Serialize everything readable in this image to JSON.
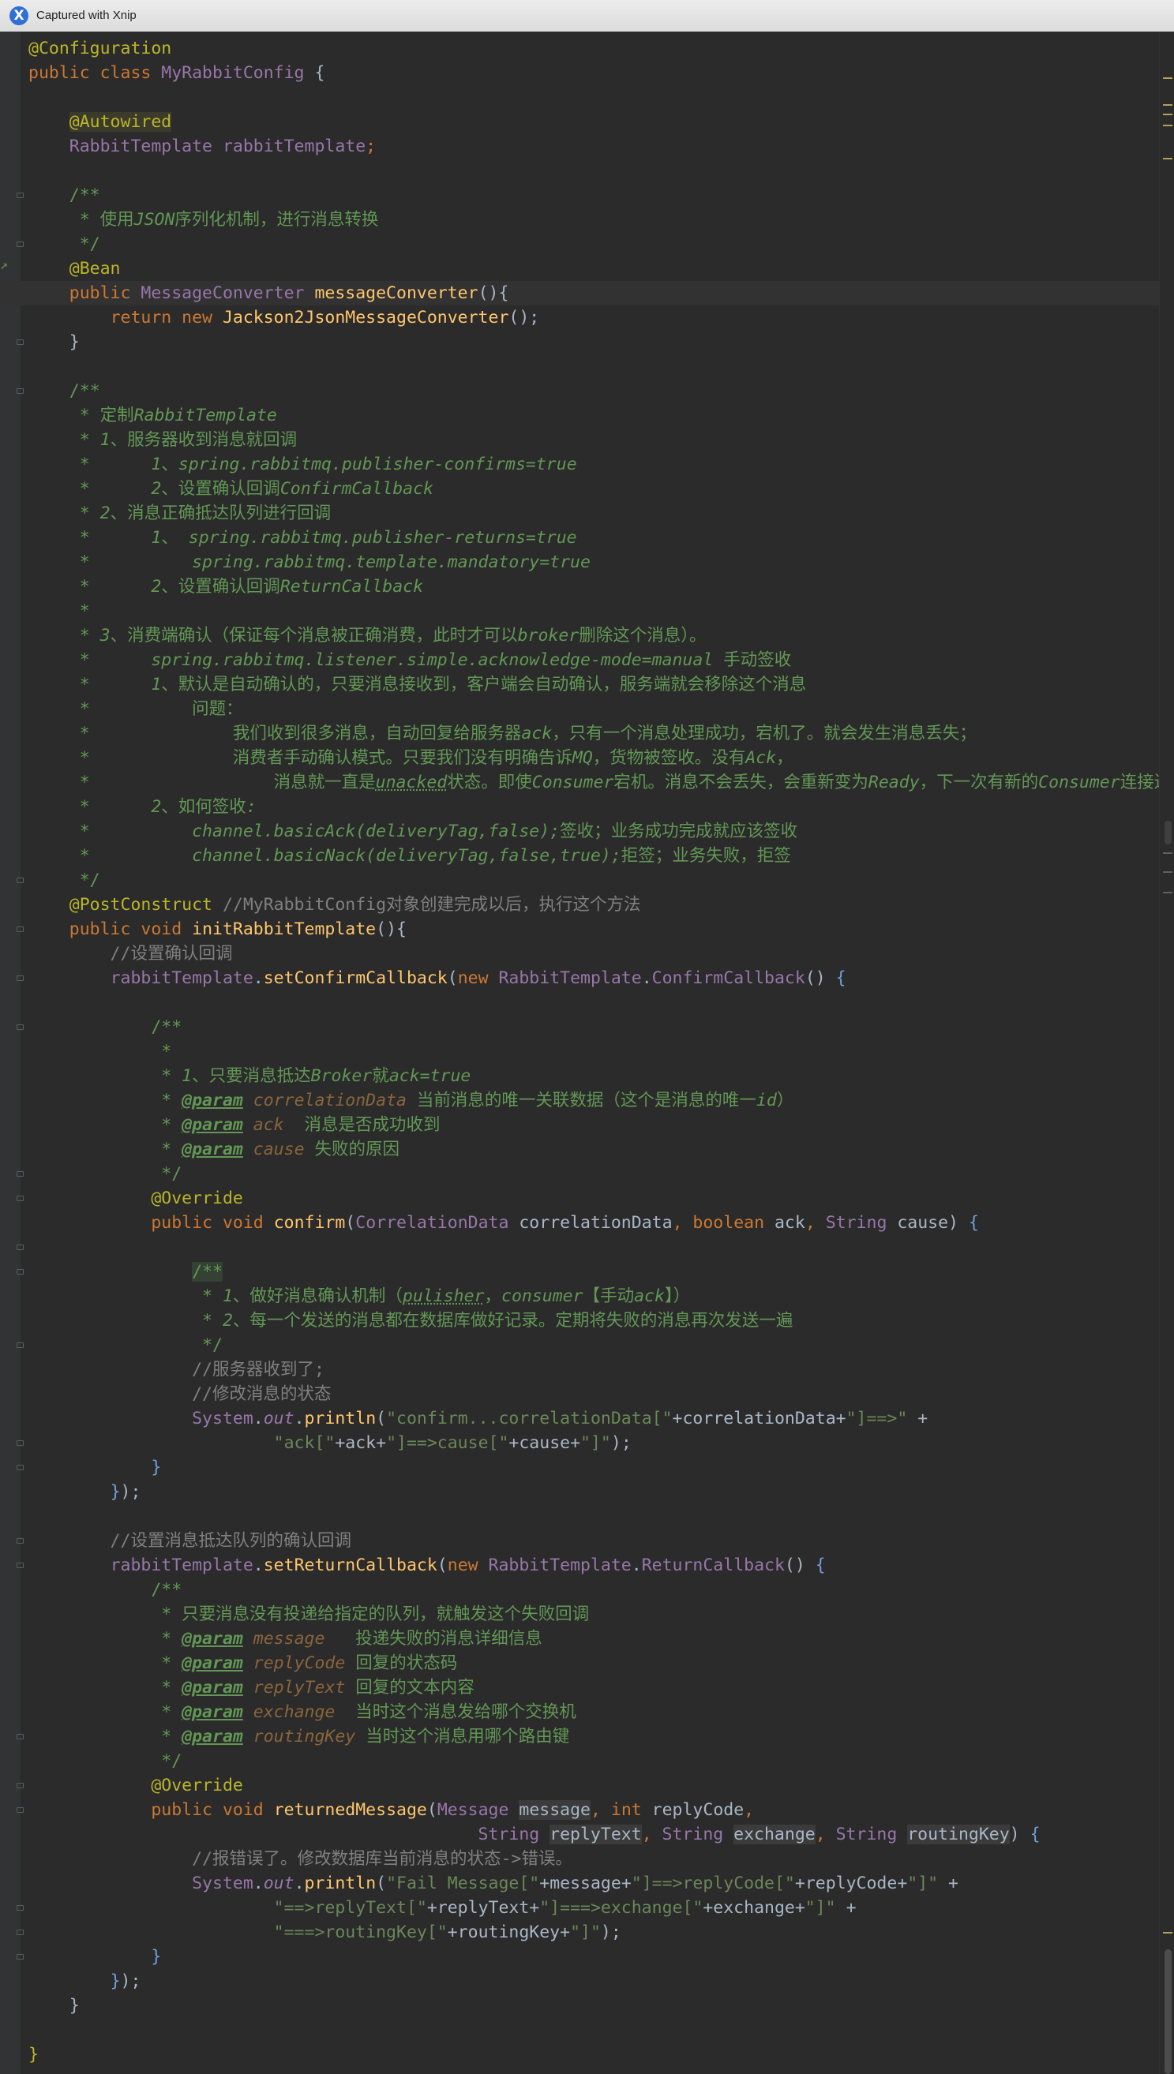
{
  "window": {
    "title": "Captured with Xnip",
    "app_icon_glyph": "X",
    "app_icon_color": "#2f6fd6"
  },
  "colors": {
    "background": "#2b2b2b",
    "keyword": "#cc7832",
    "annotation": "#bbb529",
    "class": "#9876aa",
    "method": "#ffc66d",
    "string": "#6a8759",
    "comment": "#808080",
    "doc": "#629755"
  },
  "gutter_icons": [
    "fold-icon",
    "bean-icon"
  ],
  "code": {
    "lines": [
      [
        [
          "an",
          "@Configuration"
        ]
      ],
      [
        [
          "kw",
          "public class "
        ],
        [
          "cls",
          "MyRabbitConfig "
        ],
        [
          "",
          "{"
        ]
      ],
      [
        [
          "",
          ""
        ]
      ],
      [
        [
          "",
          "    "
        ],
        [
          "an-hl",
          "@Autowired"
        ]
      ],
      [
        [
          "",
          "    "
        ],
        [
          "cls",
          "RabbitTemplate "
        ],
        [
          "fld",
          "rabbitTemplate"
        ],
        [
          "kw",
          ";"
        ]
      ],
      [
        [
          "",
          ""
        ]
      ],
      [
        [
          "dc",
          "    /**"
        ]
      ],
      [
        [
          "dc",
          "     * 使用"
        ],
        [
          "dci",
          "JSON"
        ],
        [
          "dc",
          "序列化机制，进行消息转换"
        ]
      ],
      [
        [
          "dc",
          "     */"
        ]
      ],
      [
        [
          "",
          "    "
        ],
        [
          "an",
          "@Bean"
        ]
      ],
      [
        [
          "",
          "    "
        ],
        [
          "kw",
          "public "
        ],
        [
          "cls",
          "MessageConverter "
        ],
        [
          "fn",
          "messageConverter"
        ],
        [
          "",
          "(){"
        ]
      ],
      [
        [
          "",
          "        "
        ],
        [
          "kw",
          "return new "
        ],
        [
          "fn",
          "Jackson2JsonMessageConverter"
        ],
        [
          "",
          "();"
        ]
      ],
      [
        [
          "",
          "    }"
        ]
      ],
      [
        [
          "",
          ""
        ]
      ],
      [
        [
          "dc",
          "    /**"
        ]
      ],
      [
        [
          "dc",
          "     * 定制"
        ],
        [
          "dci",
          "RabbitTemplate"
        ]
      ],
      [
        [
          "dc",
          "     * "
        ],
        [
          "dci",
          "1"
        ],
        [
          "dc",
          "、服务器收到消息就回调"
        ]
      ],
      [
        [
          "dc",
          "     *      "
        ],
        [
          "dci",
          "1"
        ],
        [
          "dc",
          "、"
        ],
        [
          "dci",
          "spring.rabbitmq.publisher-confirms=true"
        ]
      ],
      [
        [
          "dc",
          "     *      "
        ],
        [
          "dci",
          "2"
        ],
        [
          "dc",
          "、设置确认回调"
        ],
        [
          "dci",
          "ConfirmCallback"
        ]
      ],
      [
        [
          "dc",
          "     * "
        ],
        [
          "dci",
          "2"
        ],
        [
          "dc",
          "、消息正确抵达队列进行回调"
        ]
      ],
      [
        [
          "dc",
          "     *      "
        ],
        [
          "dci",
          "1"
        ],
        [
          "dc",
          "、 "
        ],
        [
          "dci",
          "spring.rabbitmq.publisher-returns=true"
        ]
      ],
      [
        [
          "dc",
          "     *          "
        ],
        [
          "dci",
          "spring.rabbitmq.template.mandatory=true"
        ]
      ],
      [
        [
          "dc",
          "     *      "
        ],
        [
          "dci",
          "2"
        ],
        [
          "dc",
          "、设置确认回调"
        ],
        [
          "dci",
          "ReturnCallback"
        ]
      ],
      [
        [
          "dc",
          "     *"
        ]
      ],
      [
        [
          "dc",
          "     * "
        ],
        [
          "dci",
          "3"
        ],
        [
          "dc",
          "、消费端确认（保证每个消息被正确消费，此时才可以"
        ],
        [
          "dci",
          "broker"
        ],
        [
          "dc",
          "删除这个消息）。"
        ]
      ],
      [
        [
          "dc",
          "     *      "
        ],
        [
          "dci",
          "spring.rabbitmq.listener.simple.acknowledge-mode=manual "
        ],
        [
          "dc",
          "手动签收"
        ]
      ],
      [
        [
          "dc",
          "     *      "
        ],
        [
          "dci",
          "1"
        ],
        [
          "dc",
          "、默认是自动确认的，只要消息接收到，客户端会自动确认，服务端就会移除这个消息"
        ]
      ],
      [
        [
          "dc",
          "     *          问题："
        ]
      ],
      [
        [
          "dc",
          "     *              我们收到很多消息，自动回复给服务器"
        ],
        [
          "dci",
          "ack"
        ],
        [
          "dc",
          "，只有一个消息处理成功，宕机了。就会发生消息丢失；"
        ]
      ],
      [
        [
          "dc",
          "     *              消费者手动确认模式。只要我们没有明确告诉"
        ],
        [
          "dci",
          "MQ"
        ],
        [
          "dc",
          "，货物被签收。没有"
        ],
        [
          "dci",
          "Ack"
        ],
        [
          "dc",
          "，"
        ]
      ],
      [
        [
          "dc",
          "     *                  消息就一直是"
        ],
        [
          "dcu",
          "unacked"
        ],
        [
          "dc",
          "状态。即使"
        ],
        [
          "dci",
          "Consumer"
        ],
        [
          "dc",
          "宕机。消息不会丢失，会重新变为"
        ],
        [
          "dci",
          "Ready"
        ],
        [
          "dc",
          "，下一次有新的"
        ],
        [
          "dci",
          "Consumer"
        ],
        [
          "dc",
          "连接进来就发给他"
        ]
      ],
      [
        [
          "dc",
          "     *      "
        ],
        [
          "dci",
          "2"
        ],
        [
          "dc",
          "、如何签收"
        ],
        [
          "dci",
          ":"
        ]
      ],
      [
        [
          "dc",
          "     *          "
        ],
        [
          "dci",
          "channel.basicAck(deliveryTag,false);"
        ],
        [
          "dc",
          "签收；业务成功完成就应该签收"
        ]
      ],
      [
        [
          "dc",
          "     *          "
        ],
        [
          "dci",
          "channel.basicNack(deliveryTag,false,true);"
        ],
        [
          "dc",
          "拒签；业务失败，拒签"
        ]
      ],
      [
        [
          "dc",
          "     */"
        ]
      ],
      [
        [
          "",
          "    "
        ],
        [
          "an",
          "@PostConstruct "
        ],
        [
          "cm",
          "//MyRabbitConfig对象创建完成以后，执行这个方法"
        ]
      ],
      [
        [
          "",
          "    "
        ],
        [
          "kw",
          "public void "
        ],
        [
          "fn",
          "initRabbitTemplate"
        ],
        [
          "",
          "(){"
        ]
      ],
      [
        [
          "cm",
          "        //设置确认回调"
        ]
      ],
      [
        [
          "",
          "        "
        ],
        [
          "fld",
          "rabbitTemplate"
        ],
        [
          "",
          "."
        ],
        [
          "fn",
          "setConfirmCallback"
        ],
        [
          "",
          "("
        ],
        [
          "kw",
          "new "
        ],
        [
          "cls",
          "RabbitTemplate"
        ],
        [
          "",
          "."
        ],
        [
          "cls",
          "ConfirmCallback"
        ],
        [
          "",
          "() "
        ],
        [
          "bl",
          "{"
        ]
      ],
      [
        [
          "",
          ""
        ]
      ],
      [
        [
          "dc",
          "            /**"
        ]
      ],
      [
        [
          "dc",
          "             *"
        ]
      ],
      [
        [
          "dc",
          "             * "
        ],
        [
          "dci",
          "1"
        ],
        [
          "dc",
          "、只要消息抵达"
        ],
        [
          "dci",
          "Broker"
        ],
        [
          "dc",
          "就"
        ],
        [
          "dci",
          "ack=true"
        ]
      ],
      [
        [
          "dc",
          "             * "
        ],
        [
          "tg",
          "@param"
        ],
        [
          "dc",
          " "
        ],
        [
          "pv",
          "correlationData"
        ],
        [
          "dc",
          " 当前消息的唯一关联数据（这个是消息的唯一"
        ],
        [
          "dci",
          "id"
        ],
        [
          "dc",
          "）"
        ]
      ],
      [
        [
          "dc",
          "             * "
        ],
        [
          "tg",
          "@param"
        ],
        [
          "dc",
          " "
        ],
        [
          "pv",
          "ack"
        ],
        [
          "dc",
          "  消息是否成功收到"
        ]
      ],
      [
        [
          "dc",
          "             * "
        ],
        [
          "tg",
          "@param"
        ],
        [
          "dc",
          " "
        ],
        [
          "pv",
          "cause"
        ],
        [
          "dc",
          " 失败的原因"
        ]
      ],
      [
        [
          "dc",
          "             */"
        ]
      ],
      [
        [
          "",
          "            "
        ],
        [
          "an",
          "@Override"
        ]
      ],
      [
        [
          "",
          "            "
        ],
        [
          "kw",
          "public void "
        ],
        [
          "fn",
          "confirm"
        ],
        [
          "",
          "("
        ],
        [
          "cls",
          "CorrelationData "
        ],
        [
          "",
          "correlationData"
        ],
        [
          "kw",
          ", boolean "
        ],
        [
          "",
          "ack"
        ],
        [
          "kw",
          ", "
        ],
        [
          "cls",
          "String "
        ],
        [
          "",
          "cause) "
        ],
        [
          "bl",
          "{"
        ]
      ],
      [
        [
          "",
          ""
        ]
      ],
      [
        [
          "",
          "                "
        ],
        [
          "dcs",
          "/**"
        ]
      ],
      [
        [
          "dc",
          "                 * "
        ],
        [
          "dci",
          "1"
        ],
        [
          "dc",
          "、做好消息确认机制（"
        ],
        [
          "dcu",
          "pulisher"
        ],
        [
          "dc",
          "，"
        ],
        [
          "dci",
          "consumer"
        ],
        [
          "dc",
          "【手动"
        ],
        [
          "dci",
          "ack"
        ],
        [
          "dc",
          "】）"
        ]
      ],
      [
        [
          "dc",
          "                 * "
        ],
        [
          "dci",
          "2"
        ],
        [
          "dc",
          "、每一个发送的消息都在数据库做好记录。定期将失败的消息再次发送一遍"
        ]
      ],
      [
        [
          "dc",
          "                 */"
        ]
      ],
      [
        [
          "cm",
          "                //服务器收到了;"
        ]
      ],
      [
        [
          "cm",
          "                //修改消息的状态"
        ]
      ],
      [
        [
          "",
          "                "
        ],
        [
          "cls",
          "System"
        ],
        [
          "",
          "."
        ],
        [
          "fld it",
          "out"
        ],
        [
          "",
          "."
        ],
        [
          "fn",
          "println"
        ],
        [
          "",
          "("
        ],
        [
          "st",
          "\"confirm...correlationData[\""
        ],
        [
          "",
          "+correlationData+"
        ],
        [
          "st",
          "\"]==>\""
        ],
        [
          "",
          " +"
        ]
      ],
      [
        [
          "",
          "                        "
        ],
        [
          "st",
          "\"ack[\""
        ],
        [
          "",
          "+ack+"
        ],
        [
          "st",
          "\"]==>cause[\""
        ],
        [
          "",
          "+cause+"
        ],
        [
          "st",
          "\"]\""
        ],
        [
          "",
          ");"
        ]
      ],
      [
        [
          "",
          "            "
        ],
        [
          "bl",
          "}"
        ]
      ],
      [
        [
          "",
          "        "
        ],
        [
          "bl",
          "}"
        ],
        [
          "",
          ");"
        ]
      ],
      [
        [
          "",
          ""
        ]
      ],
      [
        [
          "cm",
          "        //设置消息抵达队列的确认回调"
        ]
      ],
      [
        [
          "",
          "        "
        ],
        [
          "fld",
          "rabbitTemplate"
        ],
        [
          "",
          "."
        ],
        [
          "fn",
          "setReturnCallback"
        ],
        [
          "",
          "("
        ],
        [
          "kw",
          "new "
        ],
        [
          "cls",
          "RabbitTemplate"
        ],
        [
          "",
          "."
        ],
        [
          "cls",
          "ReturnCallback"
        ],
        [
          "",
          "() "
        ],
        [
          "bl",
          "{"
        ]
      ],
      [
        [
          "dc",
          "            /**"
        ]
      ],
      [
        [
          "dc",
          "             * 只要消息没有投递给指定的队列，就触发这个失败回调"
        ]
      ],
      [
        [
          "dc",
          "             * "
        ],
        [
          "tg",
          "@param"
        ],
        [
          "dc",
          " "
        ],
        [
          "pv",
          "message"
        ],
        [
          "dc",
          "   投递失败的消息详细信息"
        ]
      ],
      [
        [
          "dc",
          "             * "
        ],
        [
          "tg",
          "@param"
        ],
        [
          "dc",
          " "
        ],
        [
          "pv",
          "replyCode"
        ],
        [
          "dc",
          " 回复的状态码"
        ]
      ],
      [
        [
          "dc",
          "             * "
        ],
        [
          "tg",
          "@param"
        ],
        [
          "dc",
          " "
        ],
        [
          "pv",
          "replyText"
        ],
        [
          "dc",
          " 回复的文本内容"
        ]
      ],
      [
        [
          "dc",
          "             * "
        ],
        [
          "tg",
          "@param"
        ],
        [
          "dc",
          " "
        ],
        [
          "pv",
          "exchange"
        ],
        [
          "dc",
          "  当时这个消息发给哪个交换机"
        ]
      ],
      [
        [
          "dc",
          "             * "
        ],
        [
          "tg",
          "@param"
        ],
        [
          "dc",
          " "
        ],
        [
          "pv",
          "routingKey"
        ],
        [
          "dc",
          " 当时这个消息用哪个路由键"
        ]
      ],
      [
        [
          "dc",
          "             */"
        ]
      ],
      [
        [
          "",
          "            "
        ],
        [
          "an",
          "@Override"
        ]
      ],
      [
        [
          "",
          "            "
        ],
        [
          "kw",
          "public void "
        ],
        [
          "fn",
          "returnedMessage"
        ],
        [
          "",
          "("
        ],
        [
          "cls",
          "Message "
        ],
        [
          "occ",
          "message"
        ],
        [
          "kw",
          ", int "
        ],
        [
          "",
          "replyCode"
        ],
        [
          "kw",
          ","
        ]
      ],
      [
        [
          "",
          "                                            "
        ],
        [
          "cls",
          "String "
        ],
        [
          "occ",
          "replyText"
        ],
        [
          "kw",
          ", "
        ],
        [
          "cls",
          "String "
        ],
        [
          "occ",
          "exchange"
        ],
        [
          "kw",
          ", "
        ],
        [
          "cls",
          "String "
        ],
        [
          "occ",
          "routingKey"
        ],
        [
          "",
          ") "
        ],
        [
          "bl",
          "{"
        ]
      ],
      [
        [
          "cm",
          "                //报错误了。修改数据库当前消息的状态->错误。"
        ]
      ],
      [
        [
          "",
          "                "
        ],
        [
          "cls",
          "System"
        ],
        [
          "",
          "."
        ],
        [
          "fld it",
          "out"
        ],
        [
          "",
          "."
        ],
        [
          "fn",
          "println"
        ],
        [
          "",
          "("
        ],
        [
          "st",
          "\"Fail Message[\""
        ],
        [
          "",
          "+message+"
        ],
        [
          "st",
          "\"]==>replyCode[\""
        ],
        [
          "",
          "+replyCode+"
        ],
        [
          "st",
          "\"]\""
        ],
        [
          "",
          " +"
        ]
      ],
      [
        [
          "",
          "                        "
        ],
        [
          "st",
          "\"==>replyText[\""
        ],
        [
          "",
          "+replyText+"
        ],
        [
          "st",
          "\"]===>exchange[\""
        ],
        [
          "",
          "+exchange+"
        ],
        [
          "st",
          "\"]\""
        ],
        [
          "",
          " +"
        ]
      ],
      [
        [
          "",
          "                        "
        ],
        [
          "st",
          "\"===>routingKey[\""
        ],
        [
          "",
          "+routingKey+"
        ],
        [
          "st",
          "\"]\""
        ],
        [
          "",
          ");"
        ]
      ],
      [
        [
          "",
          "            "
        ],
        [
          "bl",
          "}"
        ]
      ],
      [
        [
          "",
          "        "
        ],
        [
          "bl",
          "}"
        ],
        [
          "",
          ");"
        ]
      ],
      [
        [
          "",
          "    }"
        ]
      ],
      [
        [
          "",
          ""
        ]
      ],
      [
        [
          "an",
          "}"
        ]
      ]
    ]
  }
}
